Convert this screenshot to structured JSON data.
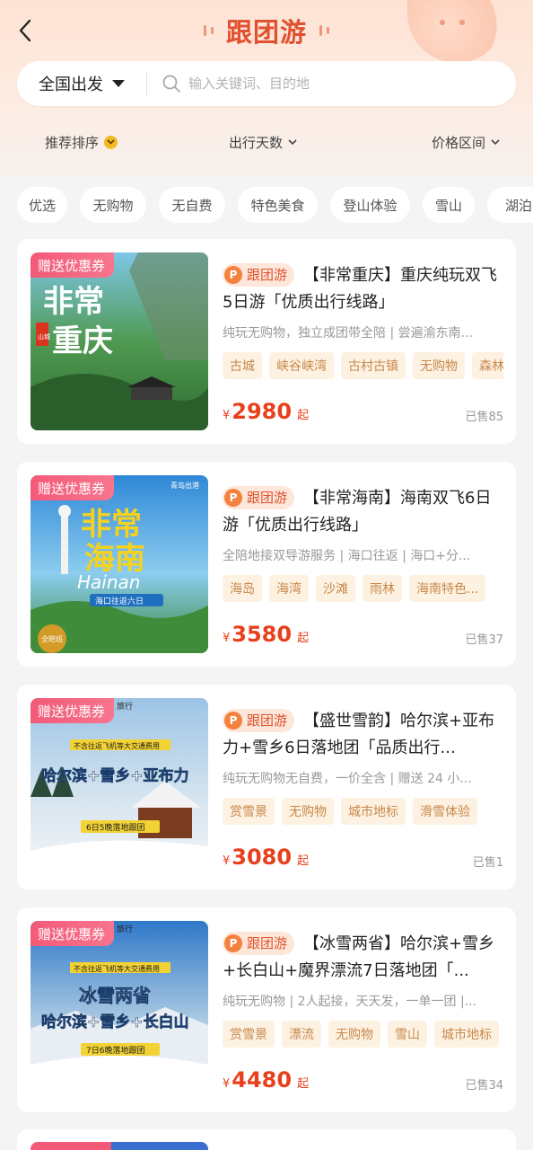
{
  "header": {
    "title": "跟团游"
  },
  "search": {
    "origin": "全国出发",
    "placeholder": "输入关键词、目的地"
  },
  "filters": {
    "sort": "推荐排序",
    "days": "出行天数",
    "price": "价格区间"
  },
  "chips": [
    "优选",
    "无购物",
    "无自费",
    "特色美食",
    "登山体验",
    "雪山",
    "湖泊"
  ],
  "cards": [
    {
      "coupon": "赠送优惠券",
      "type_tag": "跟团游",
      "title": "【非常重庆】重庆纯玩双飞5日游「优质出行线路」",
      "desc": "纯玩无购物，独立成团带全陪 | 尝遍渝东南...",
      "tags": [
        "古城",
        "峡谷峡湾",
        "古村古镇",
        "无购物",
        "森林"
      ],
      "price_symbol": "¥",
      "price": "2980",
      "price_suffix": "起",
      "sold": "已售85",
      "image_text": [
        "非常",
        "重庆",
        "山城"
      ]
    },
    {
      "coupon": "赠送优惠券",
      "type_tag": "跟团游",
      "title": "【非常海南】海南双飞6日游「优质出行线路」",
      "desc": "全陪地接双导游服务 | 海口往返 | 海口+分...",
      "tags": [
        "海岛",
        "海湾",
        "沙滩",
        "雨林",
        "海南特色..."
      ],
      "price_symbol": "¥",
      "price": "3580",
      "price_suffix": "起",
      "sold": "已售37",
      "image_text": [
        "非常",
        "海南",
        "Hainan",
        "海口往返六日",
        "青岛出港",
        "全陪班"
      ]
    },
    {
      "coupon": "赠送优惠券",
      "type_tag": "跟团游",
      "title": "【盛世雪韵】哈尔滨+亚布力+雪乡6日落地团「品质出行...",
      "desc": "纯玩无购物无自费，一价全含 | 赠送 24 小...",
      "tags": [
        "赏雪景",
        "无购物",
        "城市地标",
        "滑雪体验"
      ],
      "price_symbol": "¥",
      "price": "3080",
      "price_suffix": "起",
      "sold": "已售1",
      "image_text": [
        "不含往返飞机等大交通费用",
        "哈尔滨+雪乡+亚布力",
        "6日5晚落地跟团",
        "旅行"
      ]
    },
    {
      "coupon": "赠送优惠券",
      "type_tag": "跟团游",
      "title": "【冰雪两省】哈尔滨+雪乡+长白山+魔界漂流7日落地团「...",
      "desc": "纯玩无购物 | 2人起接，天天发，一单一团 |...",
      "tags": [
        "赏雪景",
        "漂流",
        "无购物",
        "雪山",
        "城市地标"
      ],
      "price_symbol": "¥",
      "price": "4480",
      "price_suffix": "起",
      "sold": "已售34",
      "image_text": [
        "不含往返飞机等大交通费用",
        "冰雪两省",
        "哈尔滨+雪乡+长白山",
        "7日6晚落地跟团",
        "旅行"
      ]
    }
  ],
  "colors": {
    "accent": "#e2512f",
    "price": "#e8401c",
    "coupon": "#f35a78",
    "tag_bg": "#fdf1e2",
    "tag_text": "#c8894a"
  }
}
